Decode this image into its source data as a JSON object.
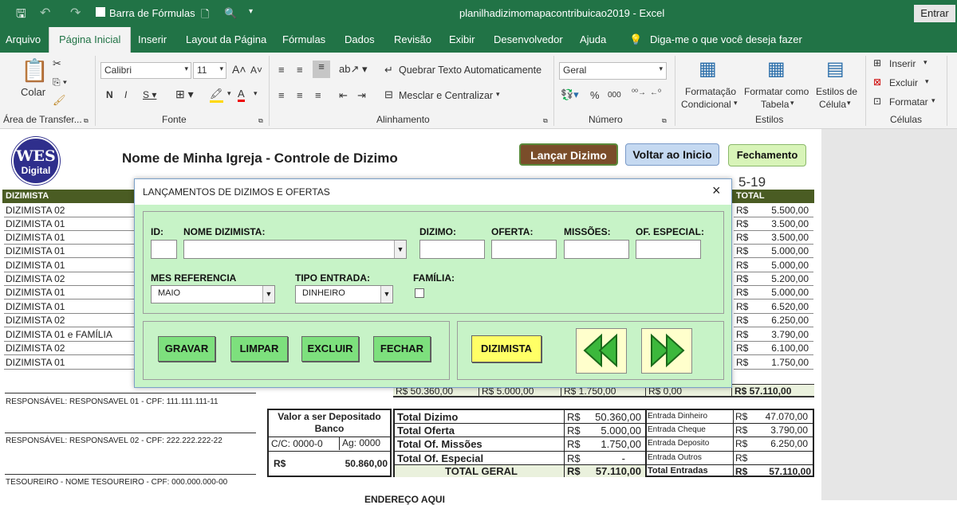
{
  "titlebar": {
    "barra_formulas": "Barra de Fórmulas",
    "file_title": "planilhadizimomapacontribuicao2019 - Excel",
    "entrar": "Entrar"
  },
  "tabs": [
    "Arquivo",
    "Página Inicial",
    "Inserir",
    "Layout da Página",
    "Fórmulas",
    "Dados",
    "Revisão",
    "Exibir",
    "Desenvolvedor",
    "Ajuda"
  ],
  "tell_me": "Diga-me o que você deseja fazer",
  "ribbon": {
    "colar": "Colar",
    "area_transfer": "Área de Transfer...",
    "font_name": "Calibri",
    "font_size": "11",
    "fonte": "Fonte",
    "quebrar": "Quebrar Texto Automaticamente",
    "mesclar": "Mesclar e Centralizar",
    "alinhamento": "Alinhamento",
    "number_format": "Geral",
    "numero": "Número",
    "formatacao": "Formatação",
    "condicional": "Condicional",
    "formatar_como": "Formatar como",
    "tabela": "Tabela",
    "estilos_de": "Estilos de",
    "celula": "Célula",
    "estilos": "Estilos",
    "inserir": "Inserir",
    "excluir": "Excluir",
    "formatar": "Formatar",
    "celulas": "Células"
  },
  "sheet": {
    "logo_top": "WES",
    "logo_bottom": "Digital",
    "title": "Nome de Minha Igreja - Controle de Dizimo",
    "btn_lancar": "Lançar Dizimo",
    "btn_voltar": "Voltar ao Inicio",
    "btn_fechamento": "Fechamento",
    "date_fragment": "5-19",
    "col_dizimista": "DIZIMISTA",
    "col_total": "TOTAL",
    "dizimistas": [
      "DIZIMISTA 02",
      "DIZIMISTA 01",
      "DIZIMISTA 01",
      "DIZIMISTA 01",
      "DIZIMISTA 01",
      "DIZIMISTA 02",
      "DIZIMISTA 01",
      "DIZIMISTA 01",
      "DIZIMISTA 02",
      "DIZIMISTA 01 e FAMÍLIA",
      "DIZIMISTA 02",
      "DIZIMISTA 01"
    ],
    "currency": "R$",
    "totals": [
      "5.500,00",
      "3.500,00",
      "3.500,00",
      "5.000,00",
      "5.000,00",
      "5.200,00",
      "5.000,00",
      "6.520,00",
      "6.250,00",
      "3.790,00",
      "6.100,00",
      "1.750,00"
    ],
    "sum_row": [
      "R$ 50.360,00",
      "R$ 5.000,00",
      "R$ 1.750,00",
      "R$ 0,00",
      "R$ 57.110,00"
    ],
    "resp1": "RESPONSÁVEL: RESPONSAVEL 01 - CPF: 111.111.111-11",
    "resp2": "RESPONSÁVEL: RESPONSAVEL 02 - CPF: 222.222.222-22",
    "tesoureiro": "TESOUREIRO - NOME TESOUREIRO - CPF: 000.000.000-00",
    "endereco": "ENDEREÇO AQUI",
    "deposito_title1": "Valor a ser Depositado",
    "deposito_title2": "Banco",
    "cc": "C/C: 0000-0",
    "ag": "Ag: 0000",
    "deposito_rs": "R$",
    "deposito_val": "50.860,00",
    "summary": [
      {
        "label": "Total Dizimo",
        "rs": "R$",
        "val": "50.360,00",
        "ent": "Entrada Dinheiro",
        "ers": "R$",
        "eval": "47.070,00"
      },
      {
        "label": "Total Oferta",
        "rs": "R$",
        "val": "5.000,00",
        "ent": "Entrada Cheque",
        "ers": "R$",
        "eval": "3.790,00"
      },
      {
        "label": "Total Of. Missões",
        "rs": "R$",
        "val": "1.750,00",
        "ent": "Entrada Deposito",
        "ers": "R$",
        "eval": "6.250,00"
      },
      {
        "label": "Total Of. Especial",
        "rs": "R$",
        "val": "-",
        "ent": "Entrada Outros",
        "ers": "R$",
        "eval": ""
      }
    ],
    "total_geral": "TOTAL GERAL",
    "total_geral_rs": "R$",
    "total_geral_val": "57.110,00",
    "total_entradas": "Total Entradas",
    "total_entradas_rs": "R$",
    "total_entradas_val": "57.110,00"
  },
  "dialog": {
    "title": "LANÇAMENTOS DE DIZIMOS E OFERTAS",
    "id": "ID:",
    "nome": "NOME DIZIMISTA:",
    "dizimo": "DIZIMO:",
    "oferta": "OFERTA:",
    "missoes": "MISSÕES:",
    "especial": "OF. ESPECIAL:",
    "mes": "MES REFERENCIA",
    "mes_value": "MAIO",
    "tipo": "TIPO ENTRADA:",
    "tipo_value": "DINHEIRO",
    "familia": "FAMÍLIA:",
    "gravar": "GRAVAR",
    "limpar": "LIMPAR",
    "excluir": "EXCLUIR",
    "fechar": "FECHAR",
    "dizimista": "DIZIMISTA"
  }
}
